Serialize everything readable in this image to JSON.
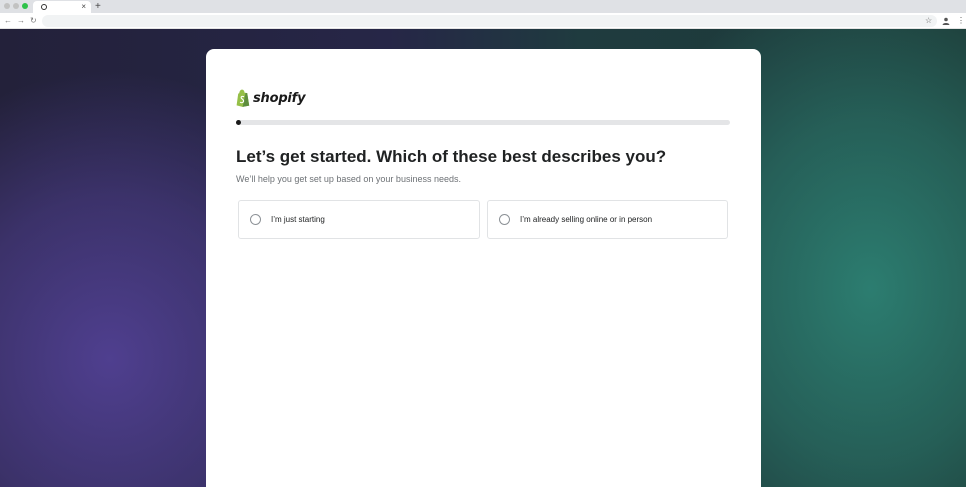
{
  "browser": {
    "tab_close": "×",
    "new_tab": "+",
    "icons": {
      "back": "back-arrow-icon",
      "forward": "forward-arrow-icon",
      "reload": "reload-icon",
      "bookmark": "star-icon",
      "profile": "profile-icon",
      "menu": "kebab-menu-icon"
    },
    "window_controls": [
      "#b5b5b5",
      "#b5b5b5",
      "#2ec24a"
    ]
  },
  "brand": {
    "name": "shopify",
    "color": "#95bf47",
    "icon": "shopify-bag-icon"
  },
  "progress": {
    "fraction": 0.01
  },
  "heading": {
    "title": "Let’s get started. Which of these best describes you?",
    "subtitle": "We’ll help you get set up based on your business needs."
  },
  "options": [
    {
      "label": "I’m just starting",
      "selected": false
    },
    {
      "label": "I’m already selling online or in person",
      "selected": false
    }
  ]
}
